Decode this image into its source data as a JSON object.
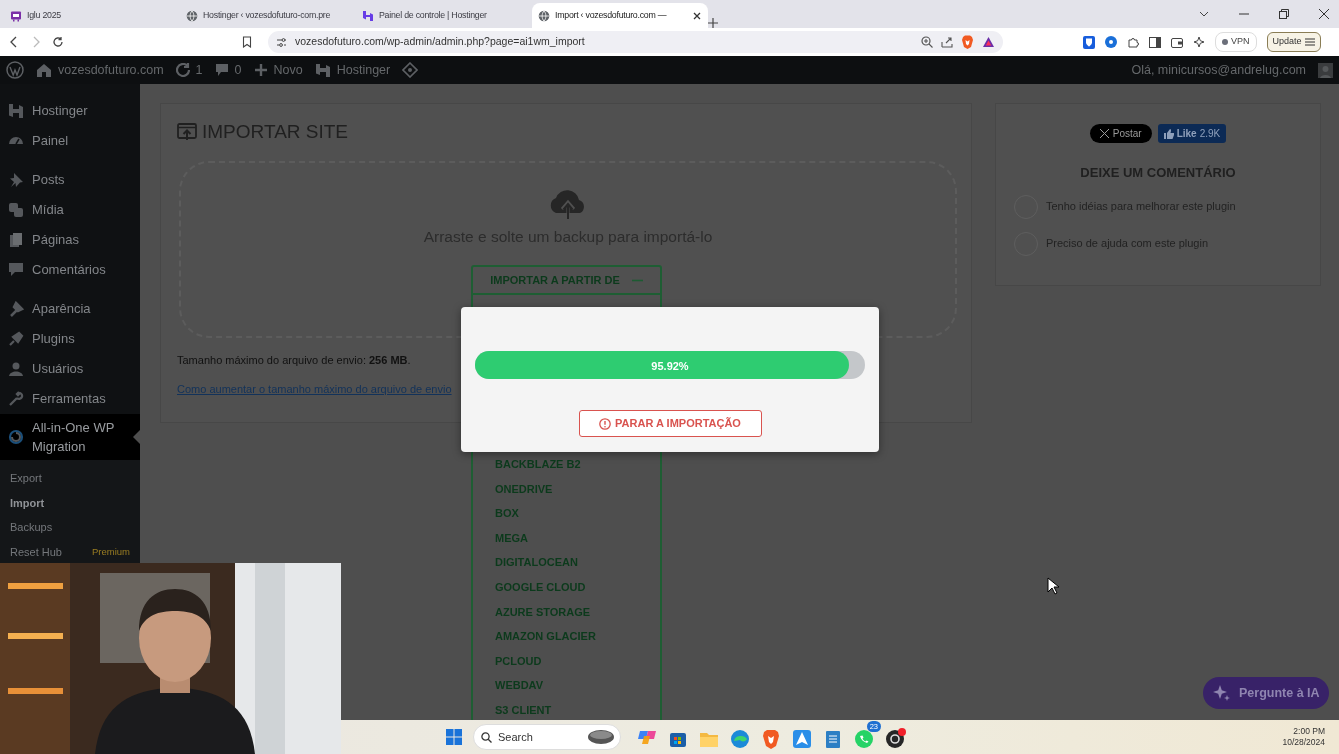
{
  "browser": {
    "tabs": [
      {
        "title": "Iglu 2025",
        "selected": false
      },
      {
        "title": "Hostinger ‹ vozesdofuturo-com.pre",
        "selected": false
      },
      {
        "title": "Painel de controle | Hostinger",
        "selected": false
      },
      {
        "title": "Import ‹ vozesdofuturo.com —",
        "selected": true
      }
    ],
    "url": "vozesdofuturo.com/wp-admin/admin.php?page=ai1wm_import",
    "vpn": "VPN",
    "update": "Update"
  },
  "admin_bar": {
    "site": "vozesdofuturo.com",
    "updates": "1",
    "comments": "0",
    "new": "Novo",
    "hostinger": "Hostinger",
    "greeting": "Olá, minicursos@andrelug.com"
  },
  "sidebar": {
    "groups": [
      {
        "items": [
          {
            "label": "Hostinger",
            "selected": false
          },
          {
            "label": "Painel",
            "selected": false
          }
        ]
      },
      {
        "items": [
          {
            "label": "Posts",
            "selected": false
          },
          {
            "label": "Mídia",
            "selected": false
          },
          {
            "label": "Páginas",
            "selected": false
          },
          {
            "label": "Comentários",
            "selected": false
          }
        ]
      },
      {
        "items": [
          {
            "label": "Aparência",
            "selected": false
          },
          {
            "label": "Plugins",
            "selected": false
          },
          {
            "label": "Usuários",
            "selected": false
          },
          {
            "label": "Ferramentas",
            "selected": false
          },
          {
            "label": "All-in-One WP Migration",
            "selected": true
          }
        ]
      }
    ],
    "submenu": [
      {
        "label": "Export",
        "selected": false
      },
      {
        "label": "Import",
        "selected": true
      },
      {
        "label": "Backups",
        "selected": false
      },
      {
        "label": "Reset Hub",
        "selected": false,
        "badge": "Premium"
      }
    ]
  },
  "import": {
    "title": "IMPORTAR SITE",
    "drop_text": "Arraste e solte um backup para importá-lo",
    "max_size": "Tamanho máximo do arquivo de envio: **256 MB**.",
    "help_link": "Como aumentar o tamanho máximo do arquivo de envio",
    "import_from": {
      "label": "IMPORTAR A PARTIR DE",
      "expanded": true,
      "options": [
        "BACKBLAZE B2",
        "ONEDRIVE",
        "BOX",
        "MEGA",
        "DIGITALOCEAN",
        "GOOGLE CLOUD",
        "AZURE STORAGE",
        "AMAZON GLACIER",
        "PCLOUD",
        "WEBDAV",
        "S3 CLIENT"
      ]
    }
  },
  "side_panel": {
    "tweet": "Postar",
    "like": "Like",
    "like_count": "2.9K",
    "heading": "DEIXE UM COMENTÁRIO",
    "choices": [
      {
        "label": "Tenho idéias para melhorar este plugin",
        "selected": false
      },
      {
        "label": "Preciso de ajuda com este plugin",
        "selected": false
      }
    ]
  },
  "progress_dialog": {
    "level": 0.9592,
    "reading": "95.92%",
    "stop_button": "PARAR A IMPORTAÇÃO"
  },
  "assistant_button": "Pergunte à IA",
  "taskbar": {
    "search_placeholder": "Search",
    "whatsapp_badge": "23",
    "time": "2:00 PM",
    "date": "10/28/2024"
  }
}
